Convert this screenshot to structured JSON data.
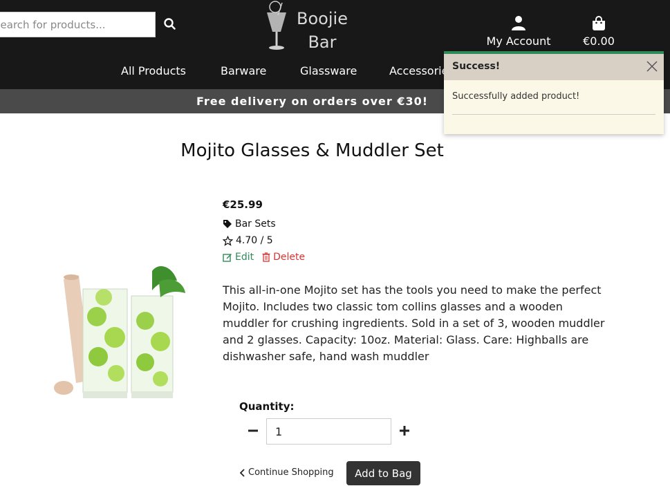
{
  "header": {
    "search": {
      "placeholder": "Search for products...",
      "value": ""
    },
    "logo": {
      "line1": "Boojie",
      "line2": "Bar"
    },
    "account_label": "My Account",
    "bag_total": "€0.00",
    "nav": [
      "All Products",
      "Barware",
      "Glassware",
      "Accessories"
    ],
    "banner": "Free delivery on orders over €30!"
  },
  "toast": {
    "title": "Success!",
    "message": "Successfully added product!",
    "accent_color": "#2e8b57"
  },
  "product": {
    "name": "Mojito Glasses & Muddler Set",
    "price": "€25.99",
    "category": "Bar Sets",
    "rating": "4.70 / 5",
    "edit_label": "Edit",
    "delete_label": "Delete",
    "description": "This all-in-one Mojito set has the tools you need to make the perfect Mojito. Includes two classic tom collins glasses and a wooden muddler for crushing ingredients. Sold in a set of 3, wooden muddler and 2 glasses. Capacity: 10oz. Material: Glass. Care: Highballs are dishwasher safe, hand wash muddler"
  },
  "purchase": {
    "quantity_label": "Quantity:",
    "quantity": "1",
    "continue_label": "Continue Shopping",
    "add_label": "Add to Bag"
  },
  "icons": [
    "search-icon",
    "user-icon",
    "shopping-bag-icon",
    "close-icon",
    "tag-icon",
    "star-icon",
    "edit-icon",
    "trash-icon",
    "minus-icon",
    "plus-icon",
    "chevron-left-icon"
  ]
}
